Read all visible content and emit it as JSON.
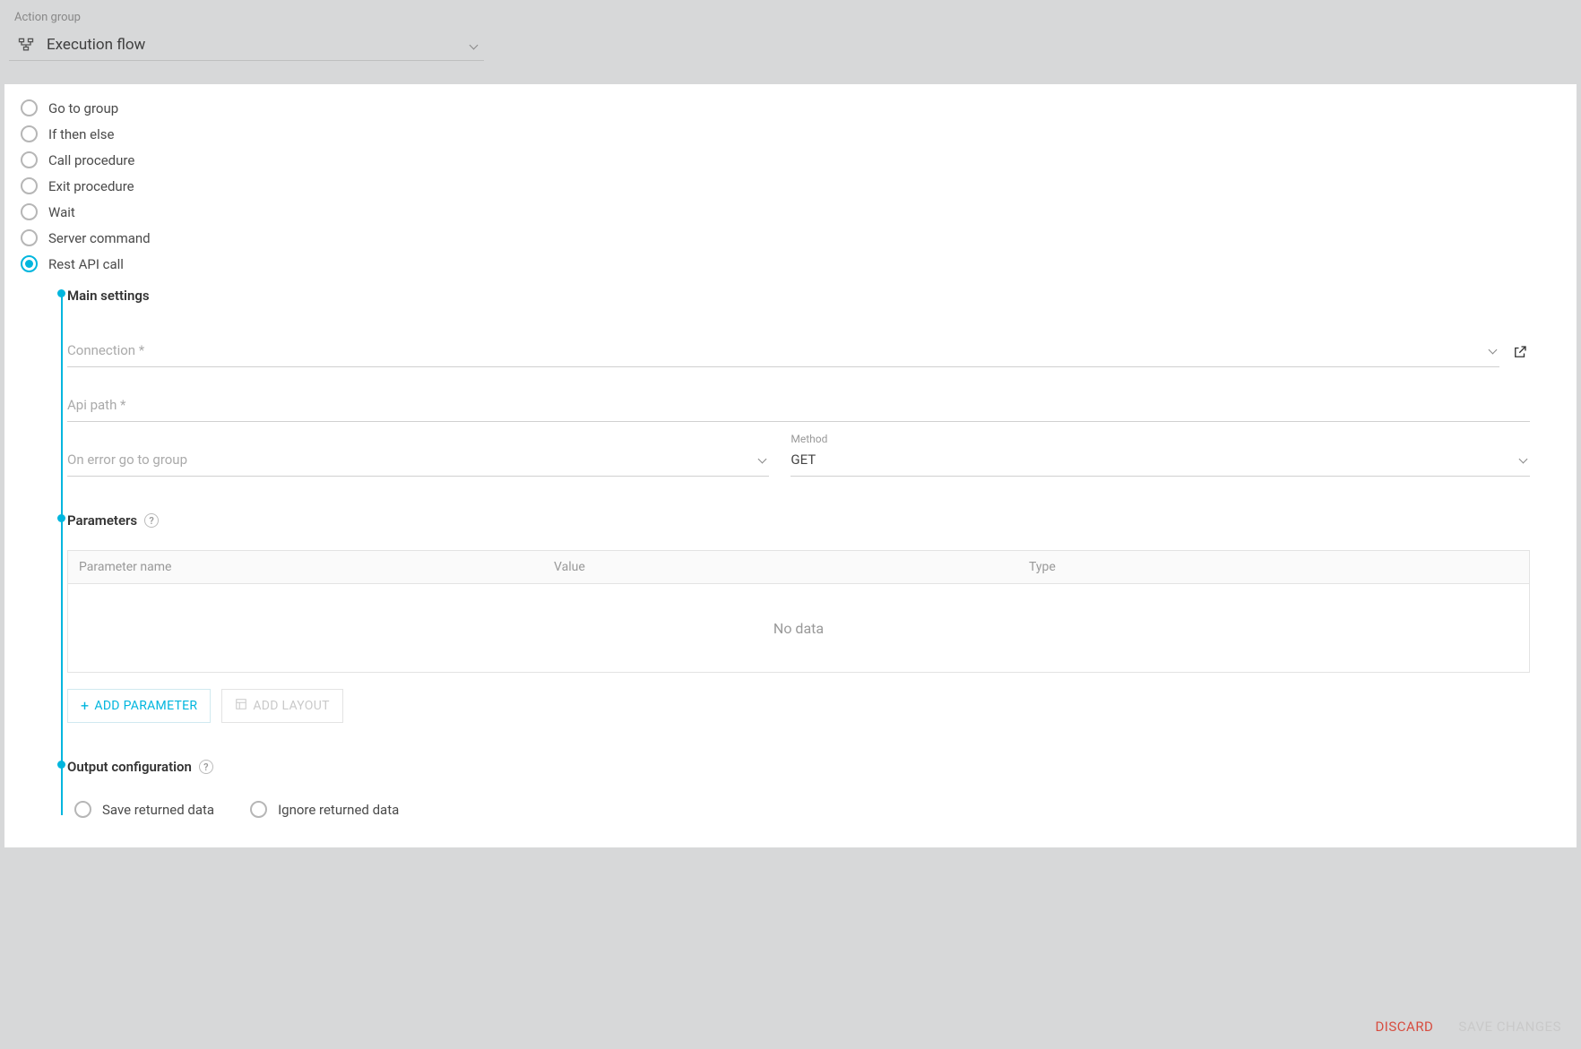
{
  "header": {
    "group_label": "Action group",
    "dropdown_value": "Execution flow"
  },
  "radio_options": [
    "Go to group",
    "If then else",
    "Call procedure",
    "Exit procedure",
    "Wait",
    "Server command",
    "Rest API call"
  ],
  "selected_radio": "Rest API call",
  "sections": {
    "main": {
      "title": "Main settings",
      "connection_placeholder": "Connection *",
      "api_path_placeholder": "Api path *",
      "on_error_placeholder": "On error go to group",
      "method_label": "Method",
      "method_value": "GET"
    },
    "parameters": {
      "title": "Parameters",
      "columns": {
        "name": "Parameter name",
        "value": "Value",
        "type": "Type"
      },
      "empty_text": "No data",
      "add_param_label": "ADD PARAMETER",
      "add_layout_label": "ADD LAYOUT"
    },
    "output": {
      "title": "Output configuration",
      "save_label": "Save returned data",
      "ignore_label": "Ignore returned data"
    }
  },
  "footer": {
    "discard": "DISCARD",
    "save": "SAVE CHANGES"
  }
}
